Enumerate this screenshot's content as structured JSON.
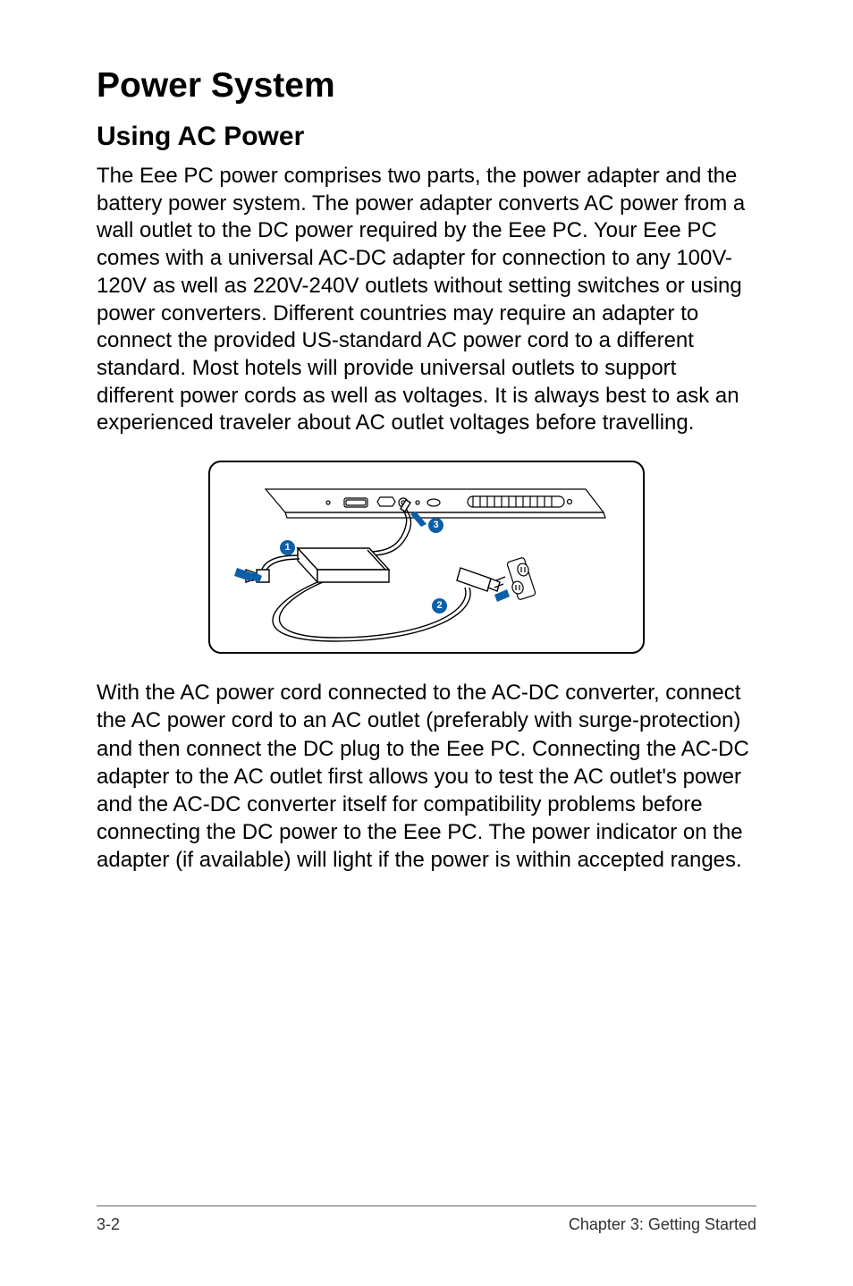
{
  "heading": "Power System",
  "subheading": "Using AC Power",
  "paragraph1": "The Eee PC power comprises two parts, the power adapter and the battery power system. The power adapter converts AC power from a wall outlet to the DC power required by the Eee PC. Your Eee PC comes with a universal AC-DC adapter for connection to any 100V-120V as well as 220V-240V outlets without setting switches or using power converters. Different countries may require an adapter to connect the provided US-standard AC power cord to a different standard. Most hotels will provide universal outlets to support different power cords as well as voltages. It is always best to ask an experienced traveler about AC outlet voltages before travelling.",
  "paragraph2": "With the AC power cord connected to the AC-DC converter, connect the AC power cord to an AC outlet (preferably with surge-protection) and then connect the DC plug to the Eee PC. Connecting the AC-DC adapter to the AC outlet first allows you to test the AC outlet's power and the AC-DC converter itself for compatibility problems before connecting the DC power to the Eee PC. The power indicator on the adapter (if available) will light if the power is within accepted ranges.",
  "callouts": {
    "one": "1",
    "two": "2",
    "three": "3"
  },
  "footer": {
    "page": "3-2",
    "chapter": "Chapter 3: Getting Started"
  }
}
